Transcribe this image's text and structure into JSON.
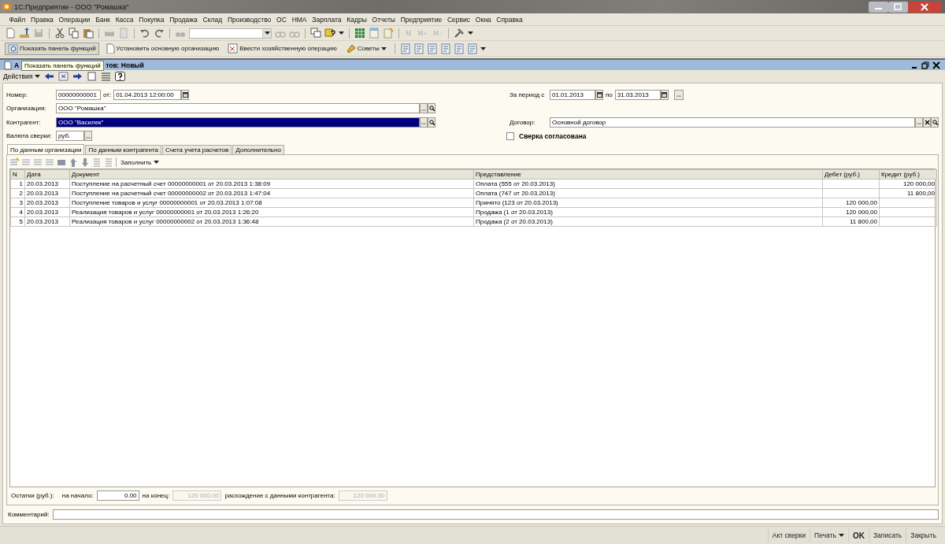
{
  "window": {
    "title": "1С:Предприятие - ООО \"Ромашка\""
  },
  "menu": [
    "Файл",
    "Правка",
    "Операции",
    "Банк",
    "Касса",
    "Покупка",
    "Продажа",
    "Склад",
    "Производство",
    "ОС",
    "НМА",
    "Зарплата",
    "Кадры",
    "Отчеты",
    "Предприятие",
    "Сервис",
    "Окна",
    "Справка"
  ],
  "memory_buttons": [
    {
      "label": "M",
      "disabled": true
    },
    {
      "label": "M+",
      "disabled": true
    },
    {
      "label": "M−",
      "disabled": true
    }
  ],
  "function_buttons": [
    {
      "label": "Показать панель функций",
      "pressed": true,
      "dropdown": false
    },
    {
      "label": "Установить основную организацию",
      "pressed": false,
      "dropdown": false
    },
    {
      "label": "Ввести хозяйственную операцию",
      "pressed": false,
      "dropdown": false
    },
    {
      "label": "Советы",
      "pressed": false,
      "dropdown": true
    }
  ],
  "tooltip": "Показать панель функций",
  "document": {
    "title_start": "А",
    "title_end": "тов: Новый",
    "actions": "Действия"
  },
  "form": {
    "number_label": "Номер:",
    "number": "00000000001",
    "date_label": "от:",
    "date": "01.04.2013 12:00:00",
    "organization_label": "Организация:",
    "organization": "ООО \"Ромашка\"",
    "counterparty_label": "Контрагент:",
    "counterparty": "ООО \"Василек\"",
    "counterparty_selected": true,
    "currency_label": "Валюта сверки:",
    "currency": "руб.",
    "period_label": "За период с",
    "period_from": "01.01.2013",
    "period_to_label": "по",
    "period_to": "31.03.2013",
    "contract_label": "Договор:",
    "contract": "Основной договор",
    "agreed_label": "Сверка согласована",
    "agreed": false
  },
  "tabs": [
    {
      "label": "По данным организации",
      "selected": true
    },
    {
      "label": "По данным контрагента",
      "selected": false
    },
    {
      "label": "Счета учета расчетов",
      "selected": false
    },
    {
      "label": "Дополнительно",
      "selected": false
    }
  ],
  "fill_button": "Заполнить",
  "table": {
    "columns": [
      "N",
      "Дата",
      "Документ",
      "Представление",
      "Дебет (руб.)",
      "Кредит (руб.)"
    ],
    "rows": [
      {
        "n": "1",
        "date": "20.03.2013",
        "document": "Поступление на расчетный счет 00000000001 от 20.03.2013 1:38:09",
        "presentation": "Оплата (555 от 20.03.2013)",
        "credit": "120 000,00"
      },
      {
        "n": "2",
        "date": "20.03.2013",
        "document": "Поступление на расчетный счет 00000000002 от 20.03.2013 1:47:04",
        "presentation": "Оплата (747 от 20.03.2013)",
        "credit": "11 800,00"
      },
      {
        "n": "3",
        "date": "20.03.2013",
        "document": "Поступление товаров и услуг 00000000001 от 20.03.2013 1:07:08",
        "presentation": "Принято (123 от 20.03.2013)",
        "debit": "120 000,00"
      },
      {
        "n": "4",
        "date": "20.03.2013",
        "document": "Реализация товаров и услуг 00000000001 от 20.03.2013 1:26:20",
        "presentation": "Продажа (1 от 20.03.2013)",
        "debit": "120 000,00"
      },
      {
        "n": "5",
        "date": "20.03.2013",
        "document": "Реализация товаров и услуг 00000000002 от 20.03.2013 1:36:48",
        "presentation": "Продажа (2 от 20.03.2013)",
        "debit": "11 800,00"
      }
    ]
  },
  "balances": {
    "label": "Остатки (руб.):",
    "start_label": "на начало:",
    "start": "0.00",
    "end_label": "на конец:",
    "end": "120 000.00",
    "diff_label": "расхождение с данными контрагента:",
    "diff": "120 000.00"
  },
  "comment_label": "Комментарий:",
  "footer_buttons": [
    {
      "label": "Акт сверки",
      "default": false,
      "dropdown": false
    },
    {
      "label": "Печать",
      "default": false,
      "dropdown": true
    },
    {
      "label": "OK",
      "default": true,
      "dropdown": false
    },
    {
      "label": "Записать",
      "default": false,
      "dropdown": false
    },
    {
      "label": "Закрыть",
      "default": false,
      "dropdown": false
    }
  ]
}
